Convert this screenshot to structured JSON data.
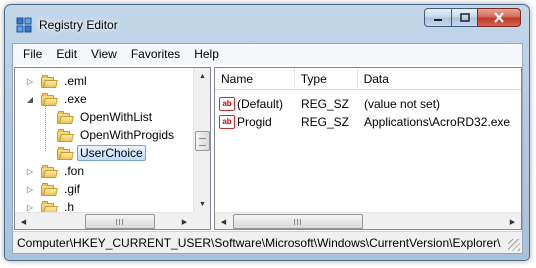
{
  "window": {
    "title": "Registry Editor",
    "title_icon": "registry-editor-icon"
  },
  "caption_buttons": [
    {
      "name": "minimize-button",
      "icon": "minimize-icon"
    },
    {
      "name": "maximize-button",
      "icon": "maximize-icon"
    },
    {
      "name": "close-button",
      "icon": "close-icon"
    }
  ],
  "menu": {
    "file": "File",
    "edit": "Edit",
    "view": "View",
    "favorites": "Favorites",
    "help": "Help"
  },
  "tree": {
    "items": [
      {
        "label": ".eml",
        "expander": "collapsed"
      },
      {
        "label": ".exe",
        "expander": "expanded"
      },
      {
        "label": "OpenWithList"
      },
      {
        "label": "OpenWithProgids"
      },
      {
        "label": "UserChoice",
        "selected": true
      },
      {
        "label": ".fon",
        "expander": "collapsed"
      },
      {
        "label": ".gif",
        "expander": "collapsed"
      },
      {
        "label": ".h",
        "expander": "collapsed"
      }
    ]
  },
  "list": {
    "columns": {
      "name": "Name",
      "type": "Type",
      "data": "Data"
    },
    "rows": [
      {
        "icon": "string-value-icon",
        "name": "(Default)",
        "type": "REG_SZ",
        "data": "(value not set)"
      },
      {
        "icon": "string-value-icon",
        "name": "Progid",
        "type": "REG_SZ",
        "data": "Applications\\AcroRD32.exe"
      }
    ]
  },
  "status": {
    "path": "Computer\\HKEY_CURRENT_USER\\Software\\Microsoft\\Windows\\CurrentVersion\\Explorer\\"
  }
}
